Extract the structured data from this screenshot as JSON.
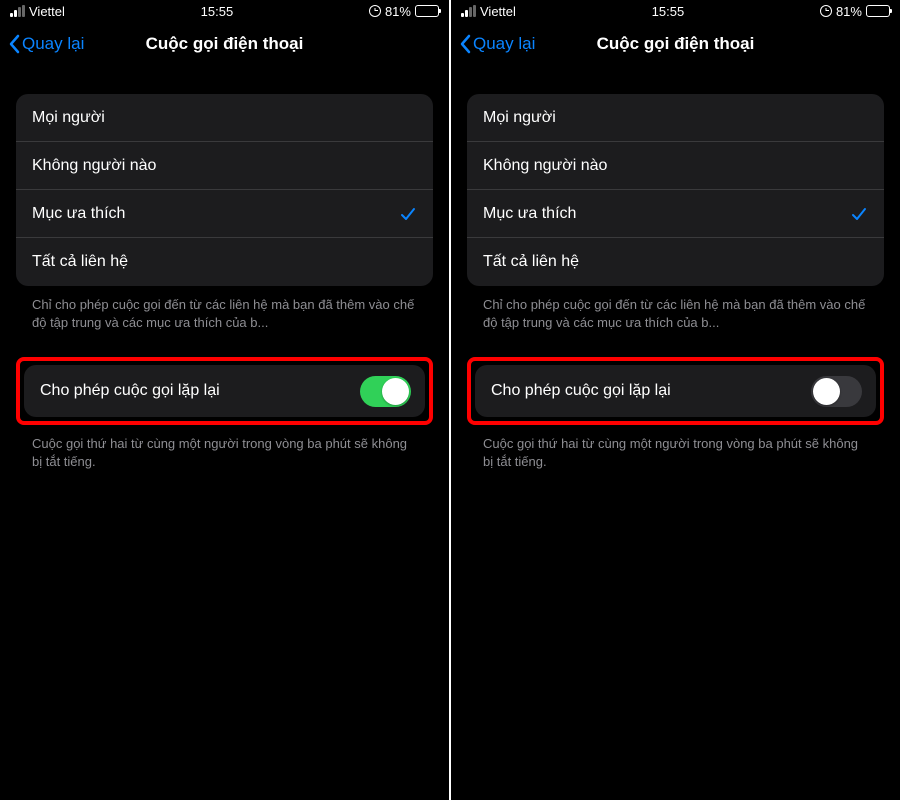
{
  "statusBar": {
    "carrier": "Viettel",
    "time": "15:55",
    "batteryPercent": "81%"
  },
  "nav": {
    "back": "Quay lại",
    "title": "Cuộc gọi điện thoại"
  },
  "allowFrom": {
    "options": [
      {
        "label": "Mọi người",
        "selected": false
      },
      {
        "label": "Không người nào",
        "selected": false
      },
      {
        "label": "Mục ưa thích",
        "selected": true
      },
      {
        "label": "Tất cả liên hệ",
        "selected": false
      }
    ],
    "footer": "Chỉ cho phép cuộc gọi đến từ các liên hệ mà bạn đã thêm vào chế độ tập trung và các mục ưa thích của b..."
  },
  "repeatCalls": {
    "label": "Cho phép cuộc gọi lặp lại",
    "footer": "Cuộc gọi thứ hai từ cùng một người trong vòng ba phút sẽ không bị tắt tiếng."
  },
  "screens": [
    {
      "toggleOn": true
    },
    {
      "toggleOn": false
    }
  ]
}
